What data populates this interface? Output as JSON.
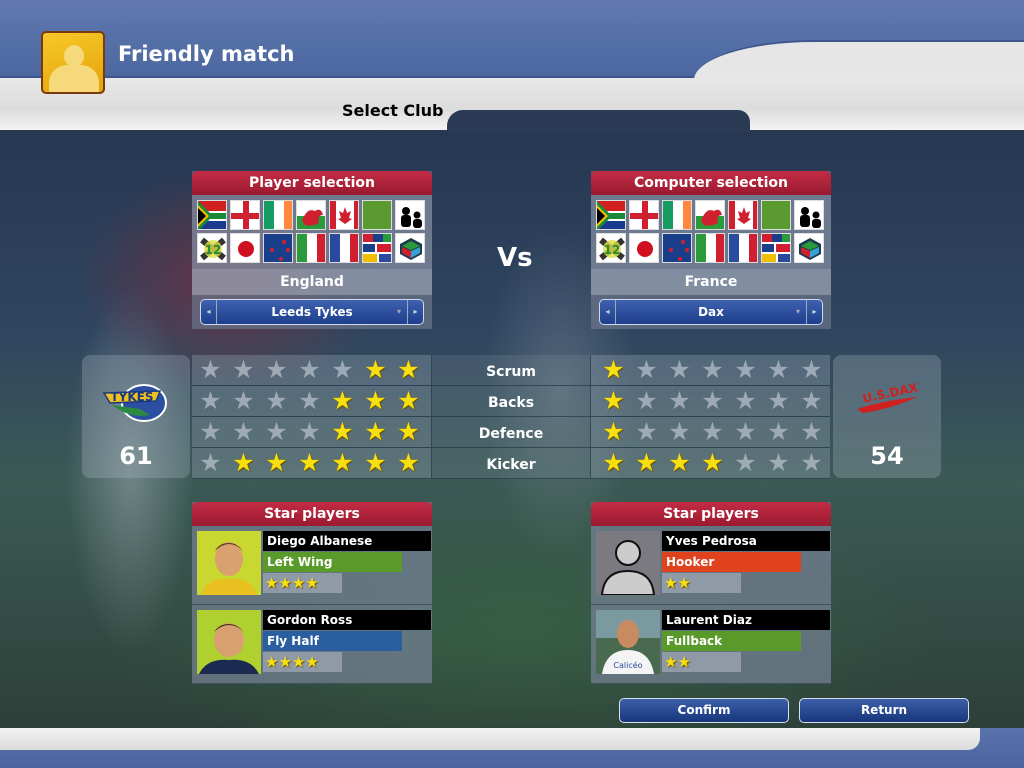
{
  "header": {
    "title": "Friendly match",
    "subtitle": "Select Club"
  },
  "vs_label": "Vs",
  "flags": [
    "south-africa",
    "england",
    "ireland",
    "wales",
    "canada",
    "blank-green",
    "two-players",
    "world-xiii",
    "japan",
    "new-zealand",
    "italy",
    "france",
    "mixed-nations",
    "custom-team"
  ],
  "player": {
    "heading": "Player selection",
    "country": "England",
    "club": "Leeds Tykes",
    "club_logo": "leeds-tykes-logo",
    "score": "61",
    "stars_heading": "Star players",
    "star_players": [
      {
        "name": "Diego Albanese",
        "position": "Left Wing",
        "position_color": "#5a9a2a",
        "rating": 4,
        "stars": "★★★★"
      },
      {
        "name": "Gordon Ross",
        "position": "Fly Half",
        "position_color": "#2a5ea0",
        "rating": 4,
        "stars": "★★★★"
      }
    ]
  },
  "computer": {
    "heading": "Computer selection",
    "country": "France",
    "club": "Dax",
    "club_logo": "us-dax-logo",
    "score": "54",
    "stars_heading": "Star players",
    "star_players": [
      {
        "name": "Yves Pedrosa",
        "position": "Hooker",
        "position_color": "#e0421e",
        "rating": 2,
        "stars": "★★"
      },
      {
        "name": "Laurent Diaz",
        "position": "Fullback",
        "position_color": "#5a9a2a",
        "rating": 2,
        "stars": "★★"
      }
    ]
  },
  "stats": {
    "max_stars": 7,
    "rows": [
      {
        "label": "Scrum",
        "player": 2,
        "computer": 1
      },
      {
        "label": "Backs",
        "player": 3,
        "computer": 1
      },
      {
        "label": "Defence",
        "player": 3,
        "computer": 1
      },
      {
        "label": "Kicker",
        "player": 6,
        "computer": 4
      }
    ]
  },
  "buttons": {
    "confirm": "Confirm",
    "return": "Return"
  },
  "icons": {
    "arrow_left": "◂",
    "arrow_right": "▸",
    "caret": "▾",
    "star": "★"
  }
}
